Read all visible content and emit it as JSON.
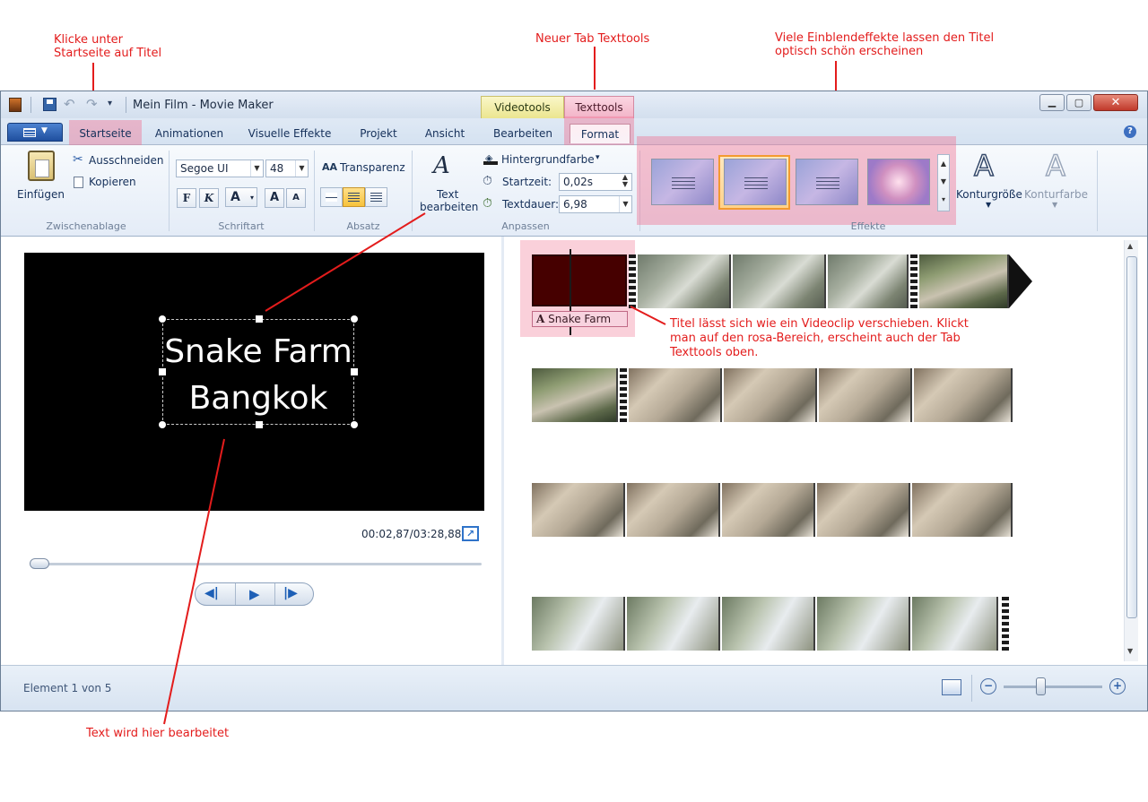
{
  "annotations": {
    "click_home_title": "Klicke unter\nStartseite auf Titel",
    "new_tab": "Neuer Tab Texttools",
    "effects": "Viele Einblendeffekte lassen den Titel\noptisch schön erscheinen",
    "title_move": "Titel lässt sich wie ein Videoclip verschieben. Klickt\nman auf den rosa-Bereich, erscheint auch der Tab\nTexttools oben.",
    "text_edit_here": "Text wird hier bearbeitet"
  },
  "window": {
    "title": "Mein Film - Movie Maker"
  },
  "context_tabs": {
    "videotools": "Videotools",
    "texttools": "Texttools"
  },
  "tabs": {
    "startseite": "Startseite",
    "animationen": "Animationen",
    "visuelle_effekte": "Visuelle Effekte",
    "projekt": "Projekt",
    "ansicht": "Ansicht",
    "bearbeiten": "Bearbeiten",
    "format": "Format"
  },
  "ribbon": {
    "clipboard": {
      "paste": "Einfügen",
      "cut": "Ausschneiden",
      "copy": "Kopieren",
      "label": "Zwischenablage"
    },
    "font": {
      "family": "Segoe UI",
      "size": "48",
      "transparency": "Transparenz",
      "bold": "F",
      "italic": "K",
      "color": "A",
      "grow": "A",
      "shrink": "A",
      "label": "Schriftart"
    },
    "paragraph": {
      "label": "Absatz"
    },
    "adjust": {
      "edit_text_line1": "Text",
      "edit_text_line2": "bearbeiten",
      "background_color": "Hintergrundfarbe",
      "start_time_label": "Startzeit:",
      "start_time_value": "0,02s",
      "duration_label": "Textdauer:",
      "duration_value": "6,98",
      "label": "Anpassen"
    },
    "effects": {
      "outline_size": "Konturgröße",
      "outline_color": "Konturfarbe",
      "label": "Effekte"
    }
  },
  "preview": {
    "title_line1": "Snake Farm",
    "title_line2": "Bangkok",
    "time": "00:02,87/03:28,88"
  },
  "timeline": {
    "title_clip_label": "Snake Farm"
  },
  "status": {
    "element_count": "Element 1 von 5"
  },
  "colors": {
    "accent_red": "#e31c1c",
    "highlight_pink": "#f08096",
    "texttools_tab": "#f6c7d6",
    "videotools_tab": "#f4f0a8"
  }
}
